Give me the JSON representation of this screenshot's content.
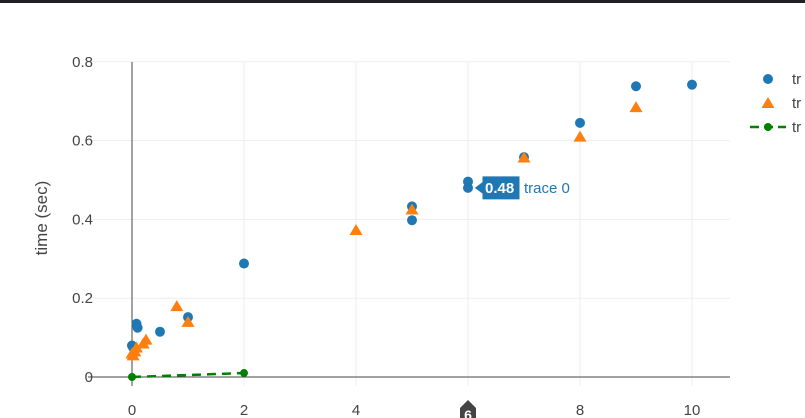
{
  "chart_data": {
    "type": "scatter",
    "title": "",
    "xlabel": "",
    "ylabel": "time (sec)",
    "xlim": [
      -0.4,
      10.7
    ],
    "ylim": [
      -0.02,
      0.8
    ],
    "x_ticks": [
      0,
      2,
      4,
      6,
      8,
      10
    ],
    "x_tick_labels": [
      "0",
      "2",
      "4",
      "",
      "8",
      "10"
    ],
    "y_ticks": [
      0,
      0.2,
      0.4,
      0.6,
      0.8
    ],
    "y_tick_labels": [
      "0",
      "0.2",
      "0.4",
      "0.6",
      "0.8"
    ],
    "grid": true,
    "legend_position": "right",
    "series": [
      {
        "name": "tr",
        "mode": "markers",
        "marker": "circle",
        "color": "#1f77b4",
        "x": [
          0,
          0.02,
          0.05,
          0.08,
          0.1,
          0.5,
          1,
          2,
          5,
          5,
          6,
          6,
          7,
          8,
          9,
          10
        ],
        "y": [
          0.08,
          0.075,
          0.07,
          0.135,
          0.125,
          0.115,
          0.152,
          0.288,
          0.433,
          0.398,
          0.496,
          0.48,
          0.558,
          0.645,
          0.738,
          0.742
        ]
      },
      {
        "name": "tr",
        "mode": "markers",
        "marker": "triangle-up",
        "color": "#ff7f0e",
        "x": [
          0,
          0.02,
          0.05,
          0.08,
          0.2,
          0.25,
          0.8,
          1,
          4,
          5,
          7,
          8,
          9
        ],
        "y": [
          0.06,
          0.055,
          0.065,
          0.075,
          0.085,
          0.095,
          0.18,
          0.14,
          0.373,
          0.425,
          0.557,
          0.61,
          0.685
        ]
      },
      {
        "name": "tr",
        "mode": "lines+markers",
        "line_dash": "dash",
        "color": "#008000",
        "x": [
          0,
          2
        ],
        "y": [
          0,
          0.01
        ]
      }
    ],
    "hover": {
      "value": "0.48",
      "name": "trace 0",
      "x": 6,
      "y": 0.48
    },
    "spike": {
      "label": "6",
      "x": 6
    }
  }
}
